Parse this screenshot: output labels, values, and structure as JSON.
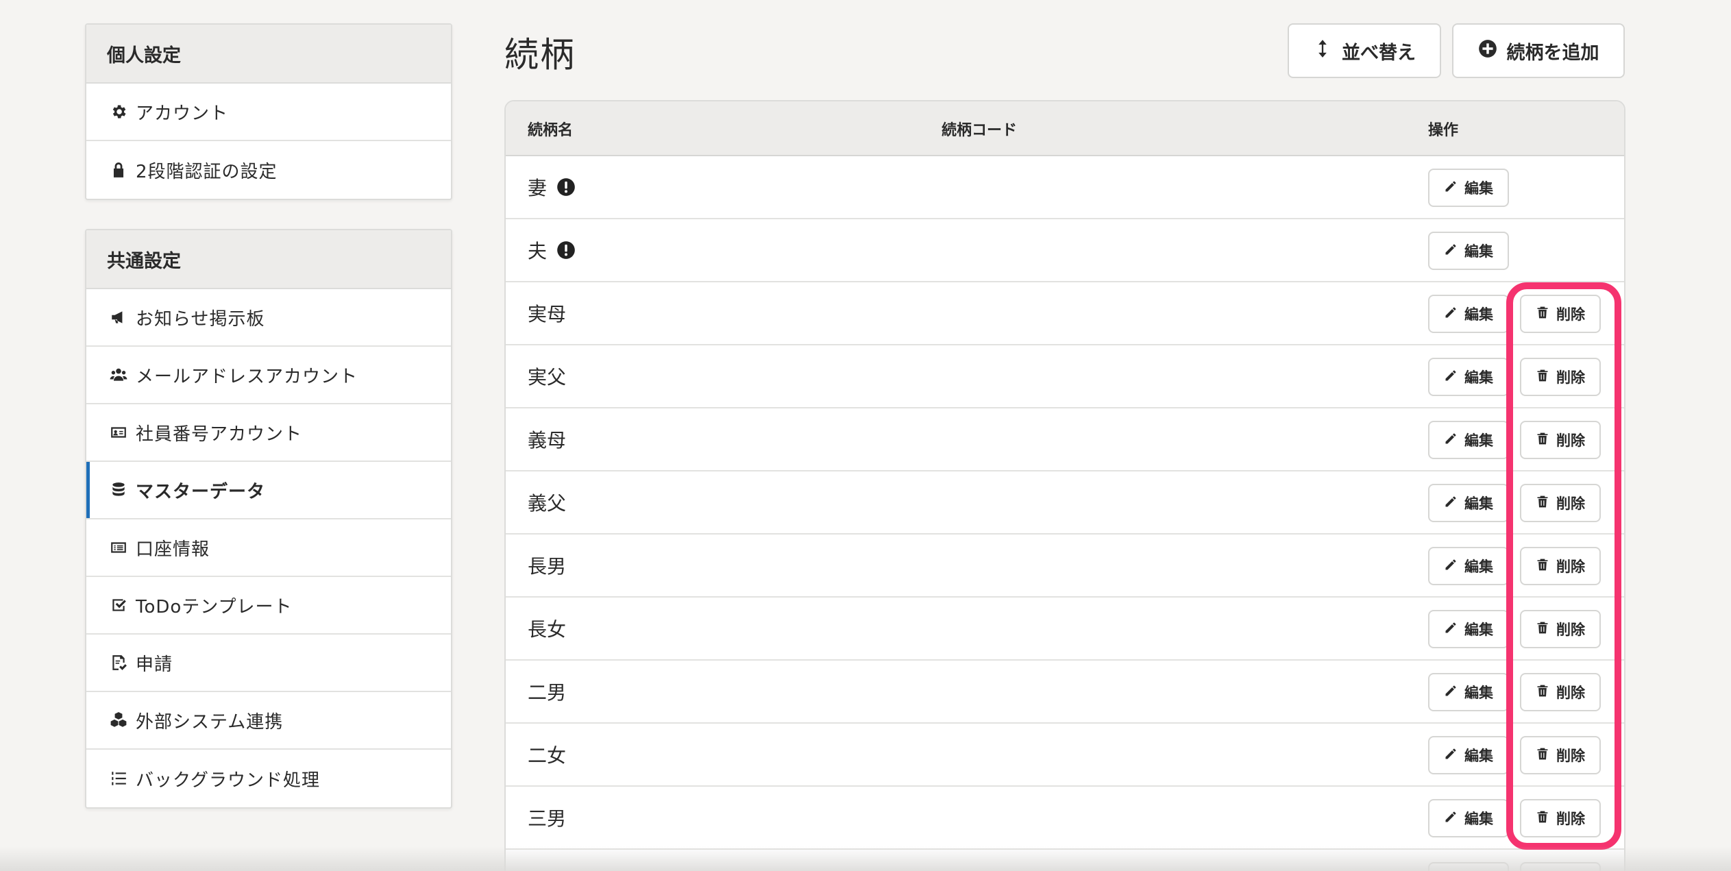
{
  "sidebar": {
    "personal": {
      "title": "個人設定",
      "items": [
        {
          "label": "アカウント",
          "icon": "gear-icon"
        },
        {
          "label": "2段階認証の設定",
          "icon": "lock-icon"
        }
      ]
    },
    "common": {
      "title": "共通設定",
      "items": [
        {
          "label": "お知らせ掲示板",
          "icon": "megaphone-icon"
        },
        {
          "label": "メールアドレスアカウント",
          "icon": "users-icon"
        },
        {
          "label": "社員番号アカウント",
          "icon": "id-card-icon"
        },
        {
          "label": "マスターデータ",
          "icon": "database-icon",
          "active": true
        },
        {
          "label": "口座情報",
          "icon": "list-card-icon"
        },
        {
          "label": "ToDoテンプレート",
          "icon": "checkbox-icon"
        },
        {
          "label": "申請",
          "icon": "document-check-icon"
        },
        {
          "label": "外部システム連携",
          "icon": "cubes-icon"
        },
        {
          "label": "バックグラウンド処理",
          "icon": "list-ol-icon"
        }
      ]
    }
  },
  "header": {
    "title": "続柄",
    "sort_label": "並べ替え",
    "add_label": "続柄を追加"
  },
  "table": {
    "columns": {
      "name": "続柄名",
      "code": "続柄コード",
      "ops": "操作"
    },
    "edit_label": "編集",
    "delete_label": "削除",
    "rows": [
      {
        "name": "妻",
        "warning": true,
        "deletable": false
      },
      {
        "name": "夫",
        "warning": true,
        "deletable": false
      },
      {
        "name": "実母",
        "warning": false,
        "deletable": true
      },
      {
        "name": "実父",
        "warning": false,
        "deletable": true
      },
      {
        "name": "義母",
        "warning": false,
        "deletable": true
      },
      {
        "name": "義父",
        "warning": false,
        "deletable": true
      },
      {
        "name": "長男",
        "warning": false,
        "deletable": true
      },
      {
        "name": "長女",
        "warning": false,
        "deletable": true
      },
      {
        "name": "二男",
        "warning": false,
        "deletable": true
      },
      {
        "name": "二女",
        "warning": false,
        "deletable": true
      },
      {
        "name": "三男",
        "warning": false,
        "deletable": true
      },
      {
        "name": "",
        "warning": false,
        "deletable": true
      }
    ]
  },
  "colors": {
    "accent": "#1f6fb8",
    "highlight": "#f5336f"
  }
}
